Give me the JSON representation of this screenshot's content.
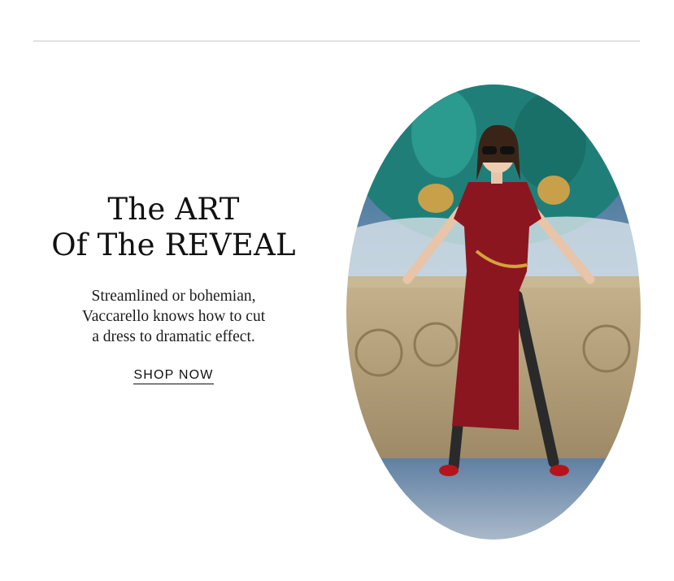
{
  "promo": {
    "headline_line1": "The ART",
    "headline_line2": "Of The REVEAL",
    "body_line1": "Streamlined or bohemian,",
    "body_line2": "Vaccarello knows how to cut",
    "body_line3": "a dress to dramatic effect.",
    "cta_label": "SHOP NOW"
  },
  "image": {
    "subject": "model in red dress at fountain",
    "colors": {
      "dress": "#8b1620",
      "fountain": "#1f7f78",
      "stone": "#b8a47c",
      "pavement": "#6f8fb0"
    }
  }
}
